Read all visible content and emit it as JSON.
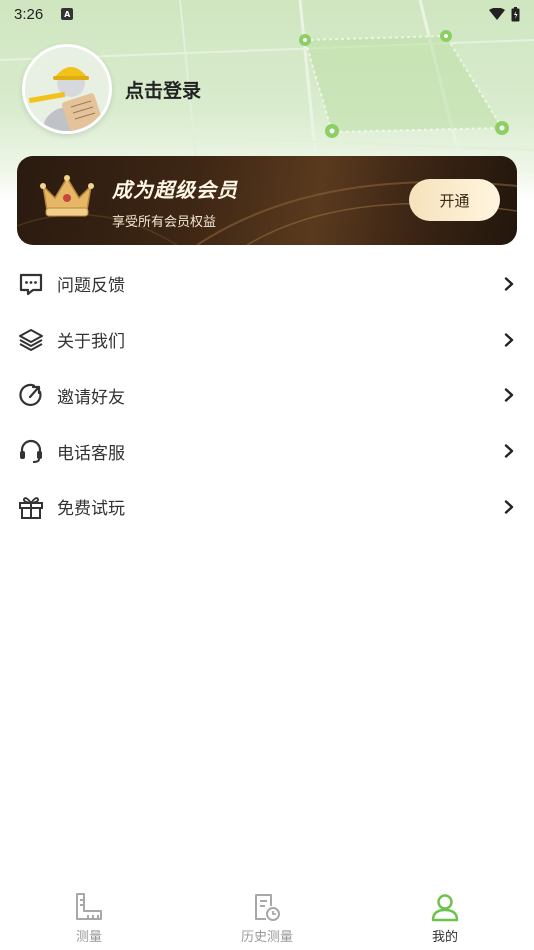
{
  "status_bar": {
    "time": "3:26"
  },
  "profile": {
    "login_text": "点击登录"
  },
  "vip": {
    "title": "成为超级会员",
    "subtitle": "享受所有会员权益",
    "button_label": "开通"
  },
  "menu": {
    "items": [
      {
        "label": "问题反馈",
        "icon": "feedback-icon"
      },
      {
        "label": "关于我们",
        "icon": "layers-icon"
      },
      {
        "label": "邀请好友",
        "icon": "share-icon"
      },
      {
        "label": "电话客服",
        "icon": "headset-icon"
      },
      {
        "label": "免费试玩",
        "icon": "gift-icon"
      }
    ]
  },
  "tabbar": {
    "tabs": [
      {
        "label": "测量",
        "icon": "ruler-icon",
        "active": false
      },
      {
        "label": "历史测量",
        "icon": "history-icon",
        "active": false
      },
      {
        "label": "我的",
        "icon": "user-icon",
        "active": true
      }
    ]
  },
  "colors": {
    "accent": "#6cc24a",
    "vip_dark": "#2a1a10",
    "vip_button": "#f6e2bc"
  }
}
